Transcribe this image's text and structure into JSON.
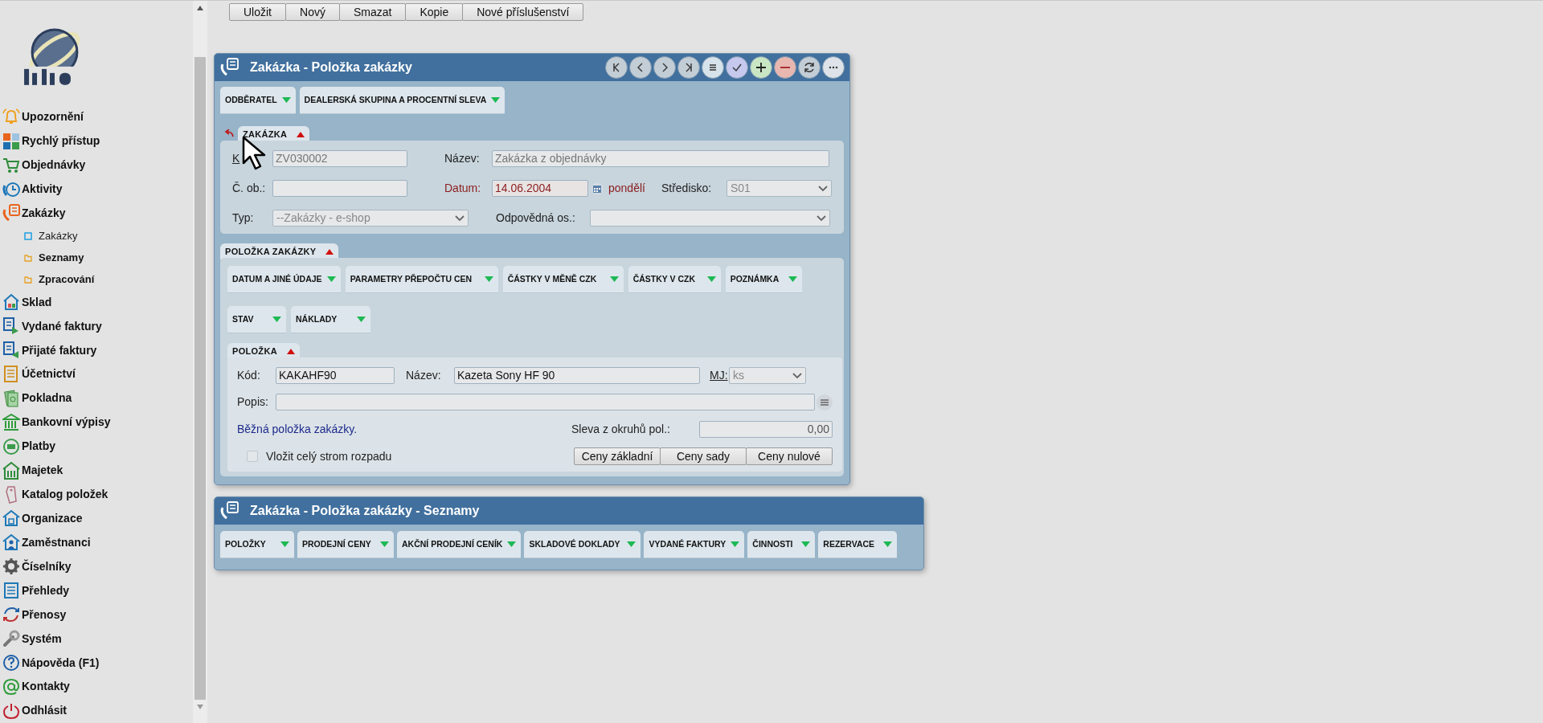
{
  "toolbar": {
    "buttons": [
      "Uložit",
      "Nový",
      "Smazat",
      "Kopie",
      "Nové příslušenství"
    ]
  },
  "sidebar": {
    "items": [
      {
        "label": "Upozornění"
      },
      {
        "label": "Rychlý přístup"
      },
      {
        "label": "Objednávky"
      },
      {
        "label": "Aktivity"
      },
      {
        "label": "Zakázky",
        "children": [
          {
            "label": "Zakázky",
            "kind": "leaf"
          },
          {
            "label": "Seznamy",
            "kind": "folder"
          },
          {
            "label": "Zpracování",
            "kind": "folder"
          }
        ]
      },
      {
        "label": "Sklad"
      },
      {
        "label": "Vydané faktury"
      },
      {
        "label": "Přijaté faktury"
      },
      {
        "label": "Účetnictví"
      },
      {
        "label": "Pokladna"
      },
      {
        "label": "Bankovní výpisy"
      },
      {
        "label": "Platby"
      },
      {
        "label": "Majetek"
      },
      {
        "label": "Katalog položek"
      },
      {
        "label": "Organizace"
      },
      {
        "label": "Zaměstnanci"
      },
      {
        "label": "Číselníky"
      },
      {
        "label": "Přehledy"
      },
      {
        "label": "Přenosy"
      },
      {
        "label": "Systém"
      },
      {
        "label": "Nápověda (F1)"
      },
      {
        "label": "Kontakty"
      },
      {
        "label": "Odhlásit"
      }
    ]
  },
  "detail_window": {
    "title": "Zakázka - Položka zakázky",
    "tabs": [
      {
        "label": "ODBĚRATEL",
        "expanded": false
      },
      {
        "label": "DEALERSKÁ SKUPINA A PROCENTNÍ SLEVA",
        "expanded": false
      }
    ],
    "order_section": {
      "title": "ZAKÁZKA",
      "expanded": true,
      "code": {
        "label": "K",
        "value": "ZV030002",
        "disabled": true
      },
      "name": {
        "label": "Název:",
        "value": "Zakázka z objednávky",
        "disabled": true
      },
      "order_no": {
        "label": "Č. ob.:"
      },
      "date": {
        "label": "Datum:",
        "value": "14.06.2004",
        "weekday": "pondělí"
      },
      "center": {
        "label": "Středisko:",
        "value": "S01",
        "disabled": true
      },
      "type": {
        "label": "Typ:",
        "value": "--Zakázky - e-shop",
        "disabled": true
      },
      "responsible": {
        "label": "Odpovědná os.:"
      }
    },
    "item_section": {
      "title": "POLOŽKA ZAKÁZKY",
      "expanded": true,
      "tabs": [
        {
          "label": "DATUM A JINÉ ÚDAJE",
          "expanded": false
        },
        {
          "label": "PARAMETRY PŘEPOČTU CEN",
          "expanded": false
        },
        {
          "label": "ČÁSTKY V MĚNĚ CZK",
          "expanded": false
        },
        {
          "label": "ČÁSTKY V CZK",
          "expanded": false
        },
        {
          "label": "POZNÁMKA",
          "expanded": false
        },
        {
          "label": "STAV",
          "expanded": false
        },
        {
          "label": "NÁKLADY",
          "expanded": false
        }
      ],
      "item": {
        "title": "POLOŽKA",
        "expanded": true,
        "code": {
          "label": "Kód:",
          "value": "KAKAHF90",
          "disabled": false
        },
        "name": {
          "label": "Název:",
          "value": "Kazeta Sony HF 90",
          "disabled": false
        },
        "unit": {
          "label": "MJ:",
          "value": "ks",
          "disabled": true
        },
        "description": {
          "label": "Popis:"
        },
        "note": "Běžná položka zakázky.",
        "discount": {
          "label": "Sleva z okruhů pol.:",
          "value": "0,00"
        },
        "checkbox": {
          "label": "Vložit celý strom rozpadu",
          "checked": false
        },
        "price_buttons": [
          "Ceny základní",
          "Ceny sady",
          "Ceny nulové"
        ]
      }
    }
  },
  "lists_window": {
    "title": "Zakázka - Položka zakázky - Seznamy",
    "tabs": [
      {
        "label": "POLOŽKY",
        "expanded": false
      },
      {
        "label": "PRODEJNÍ CENY",
        "expanded": false
      },
      {
        "label": "AKČNÍ PRODEJNÍ CENÍK",
        "expanded": false
      },
      {
        "label": "SKLADOVÉ DOKLADY",
        "expanded": false
      },
      {
        "label": "VYDANÉ FAKTURY",
        "expanded": false
      },
      {
        "label": "ČINNOSTI",
        "expanded": false
      },
      {
        "label": "REZERVACE",
        "expanded": false
      }
    ]
  }
}
